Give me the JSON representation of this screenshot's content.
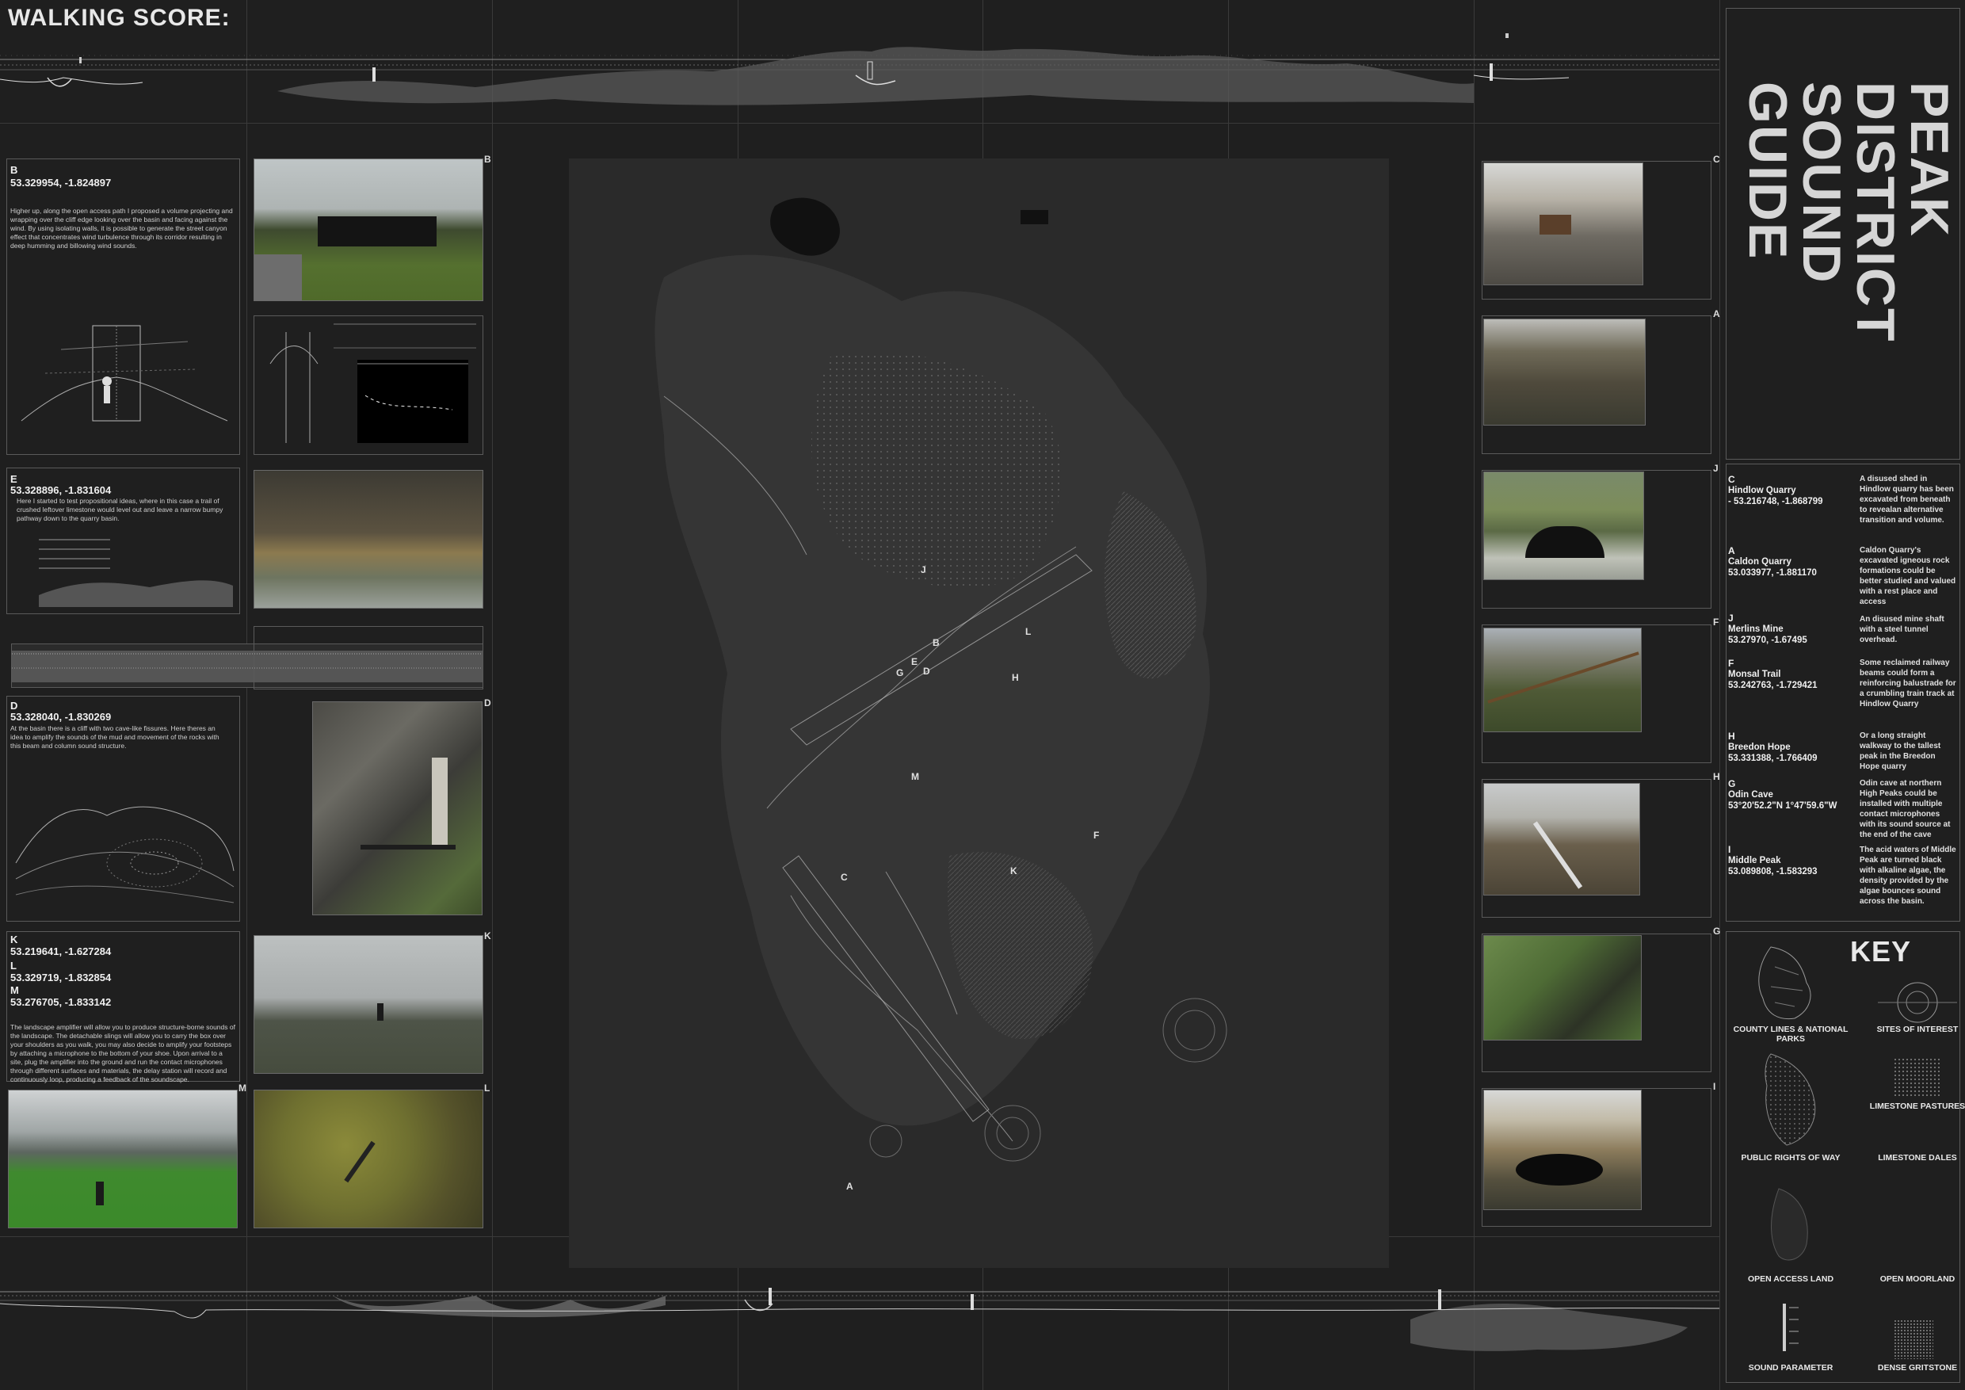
{
  "header": {
    "title": "WALKING SCORE:"
  },
  "poster_title": {
    "lines": [
      "PEAK",
      "DISTRICT",
      "SOUND",
      "GUIDE"
    ]
  },
  "left_panels": {
    "b": {
      "tag": "B",
      "coords": "53.329954, -1.824897",
      "text": "Higher up, along the open access path I proposed a volume projecting and wrapping over the cliff edge looking over the basin and facing against the wind. By using isolating walls, it is possible to generate the street canyon effect that concentrates wind turbulence through its corridor resulting in deep humming and billowing wind sounds."
    },
    "b_photo_tag": "B",
    "e": {
      "tag": "E",
      "coords": "53.328896, -1.831604",
      "text": "Here I started to test propositional ideas, where in this case a trail of crushed leftover limestone would level out and leave a narrow bumpy pathway down to the quarry basin."
    },
    "d": {
      "tag": "D",
      "coords": "53.328040, -1.830269",
      "text": "At the basin there is a cliff with two cave-like fissures. Here theres an idea to amplify the sounds of the mud and movement of the rocks with this beam and column sound structure."
    },
    "d_photo_tag": "D",
    "k": {
      "tag": "K",
      "coords": "53.219641, -1.627284",
      "l_tag": "L",
      "l_coords": "53.329719, -1.832854",
      "m_tag": "M",
      "m_coords": "53.276705, -1.833142",
      "text": "The landscape amplifier will allow you to produce structure-borne sounds of the landscape. The detachable slings will allow you to carry the box over your shoulders as you walk, you may also decide to amplify your footsteps by attaching a microphone to the bottom of your shoe. Upon arrival to a site, plug the amplifier into the ground and run the contact microphones through different surfaces and materials, the delay station will record and continuously loop, producing a feedback of the soundscape."
    },
    "k_photo_tag": "K",
    "m_photo_tag": "M",
    "l_photo_tag": "L"
  },
  "map_labels": [
    "J",
    "B",
    "L",
    "E",
    "G",
    "D",
    "H",
    "M",
    "F",
    "K",
    "C",
    "A"
  ],
  "right_photo_tags": [
    "C",
    "A",
    "J",
    "F",
    "H",
    "G",
    "I"
  ],
  "sites": [
    {
      "letter": "C",
      "name": "Hindlow Quarry",
      "coord": " - 53.216748, -1.868799",
      "desc": "A disused shed in Hindlow quarry has been excavated from beneath to revealan alternative transition and volume."
    },
    {
      "letter": "A",
      "name": "Caldon Quarry",
      "coord": "53.033977, -1.881170",
      "desc": "Caldon Quarry's excavated igneous rock formations could be better studied and valued with a rest place and access"
    },
    {
      "letter": "J",
      "name": "Merlins Mine",
      "coord": "53.27970, -1.67495",
      "desc": "An disused mine shaft with a steel tunnel overhead."
    },
    {
      "letter": "F",
      "name": "Monsal Trail",
      "coord": "53.242763, -1.729421",
      "desc": "Some reclaimed railway beams could form a reinforcing balustrade for a crumbling train track at Hindlow Quarry"
    },
    {
      "letter": "H",
      "name": "Breedon Hope",
      "coord": "53.331388, -1.766409",
      "desc": "Or a long straight walkway to the tallest peak in the Breedon Hope quarry"
    },
    {
      "letter": "G",
      "name": "Odin Cave",
      "coord": "53°20'52.2\"N 1°47'59.6\"W",
      "desc": "Odin cave at northern High Peaks could be installed with multiple contact microphones with its sound source at the end of the cave"
    },
    {
      "letter": "I",
      "name": "Middle Peak",
      "coord": "53.089808, -1.583293",
      "desc": "The acid waters of Middle Peak are turned black with alkaline algae, the density provided by the algae bounces sound across the basin."
    }
  ],
  "key": {
    "title": "KEY",
    "items": [
      "COUNTY LINES & NATIONAL PARKS",
      "SITES OF INTEREST",
      "LIMESTONE PASTURES",
      "PUBLIC RIGHTS OF WAY",
      "LIMESTONE DALES",
      "OPEN ACCESS LAND",
      "OPEN MOORLAND",
      "SOUND PARAMETER",
      "DENSE GRITSTONE"
    ]
  },
  "colors": {
    "background": "#1f1f1f",
    "grid": "#3a3a3a",
    "text": "#e4e4e4",
    "title": "#d6d6d6",
    "map": "#2c2c2c"
  }
}
